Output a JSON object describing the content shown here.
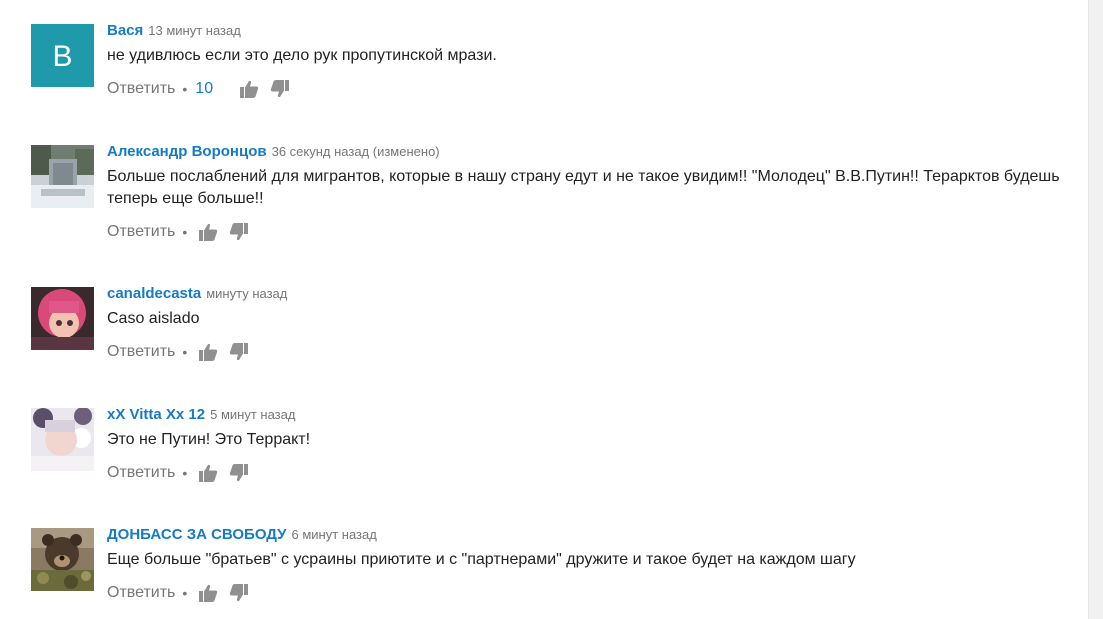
{
  "comments": [
    {
      "author": "Вася",
      "time": "13 минут назад",
      "text": "не удивлюсь если это дело рук пропутинской мрази.",
      "reply_label": "Ответить",
      "separator": "•",
      "likes": "10",
      "avatar": {
        "type": "letter",
        "letter": "B",
        "color": "#1e9aab"
      }
    },
    {
      "author": "Александр Воронцов",
      "time": "36 секунд назад (изменено)",
      "text": "Больше послаблений для мигрантов, которые в нашу страну едут и не такое увидим!! \"Молодец\" В.В.Путин!! Терарктов будешь теперь еще больше!!",
      "reply_label": "Ответить",
      "separator": "•",
      "likes": "",
      "avatar": {
        "type": "photo",
        "description": "snowy-monument"
      }
    },
    {
      "author": "canaldecasta",
      "time": "минуту назад",
      "text": "Caso aislado",
      "reply_label": "Ответить",
      "separator": "•",
      "likes": "",
      "avatar": {
        "type": "photo",
        "description": "anime-girl-pink-hair"
      }
    },
    {
      "author": "xX Vitta Xx 12",
      "time": "5 минут назад",
      "text": "Это не Путин! Это Терракт!",
      "reply_label": "Ответить",
      "separator": "•",
      "likes": "",
      "avatar": {
        "type": "photo",
        "description": "girl-white-flowers"
      }
    },
    {
      "author": "ДОНБАСС ЗА СВОБОДУ",
      "time": "6 минут назад",
      "text": "Еще больше \"братьев\"  с усраины приютите и с \"партнерами\" дружите и такое будет на каждом шагу",
      "reply_label": "Ответить",
      "separator": "•",
      "likes": "",
      "avatar": {
        "type": "photo",
        "description": "bear-in-camouflage"
      }
    }
  ],
  "icons": {
    "like": "thumbs-up-icon",
    "dislike": "thumbs-down-icon"
  },
  "colors": {
    "author_link": "#167ac6",
    "meta_text": "#767676",
    "body_text": "#222222",
    "icon": "#909090"
  }
}
